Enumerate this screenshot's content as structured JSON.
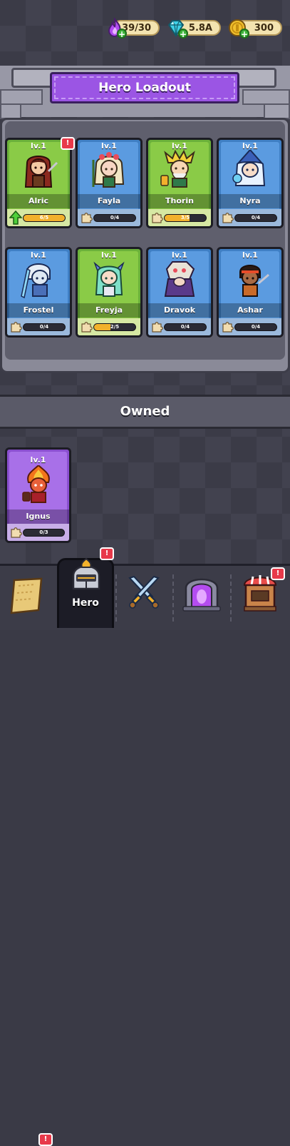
{
  "currencies": [
    {
      "name": "energy",
      "value": "39/30",
      "icon": "purple-flame-icon"
    },
    {
      "name": "gems",
      "value": "5.8A",
      "icon": "diamond-icon"
    },
    {
      "name": "coins",
      "value": "300",
      "icon": "gold-coin-icon"
    }
  ],
  "header": {
    "title": "Hero Loadout"
  },
  "loadout": [
    {
      "name": "Alric",
      "level": "lv.1",
      "progress": "6/5",
      "fill": 1.0,
      "rarity": "green",
      "badge": "!",
      "upgrade": true
    },
    {
      "name": "Fayla",
      "level": "lv.1",
      "progress": "0/4",
      "fill": 0.0,
      "rarity": "blue"
    },
    {
      "name": "Thorin",
      "level": "lv.1",
      "progress": "3/5",
      "fill": 0.6,
      "rarity": "green"
    },
    {
      "name": "Nyra",
      "level": "lv.1",
      "progress": "0/4",
      "fill": 0.0,
      "rarity": "blue"
    },
    {
      "name": "Frostel",
      "level": "lv.1",
      "progress": "0/4",
      "fill": 0.0,
      "rarity": "blue"
    },
    {
      "name": "Freyja",
      "level": "lv.1",
      "progress": "2/5",
      "fill": 0.4,
      "rarity": "green"
    },
    {
      "name": "Dravok",
      "level": "lv.1",
      "progress": "0/4",
      "fill": 0.0,
      "rarity": "blue"
    },
    {
      "name": "Ashar",
      "level": "lv.1",
      "progress": "0/4",
      "fill": 0.0,
      "rarity": "blue"
    }
  ],
  "owned": {
    "title": "Owned",
    "heroes": [
      {
        "name": "Ignus",
        "level": "lv.1",
        "progress": "0/3",
        "fill": 0.0,
        "rarity": "purple"
      }
    ]
  },
  "nav": {
    "items": [
      {
        "id": "map",
        "icon": "map-scroll-icon",
        "badge": "!"
      },
      {
        "id": "hero",
        "label": "Hero",
        "icon": "knight-helmet-icon",
        "badge": "!",
        "active": true
      },
      {
        "id": "battle",
        "icon": "crossed-swords-icon"
      },
      {
        "id": "portal",
        "icon": "portal-icon"
      },
      {
        "id": "shop",
        "icon": "shop-icon",
        "badge": "!"
      }
    ]
  }
}
